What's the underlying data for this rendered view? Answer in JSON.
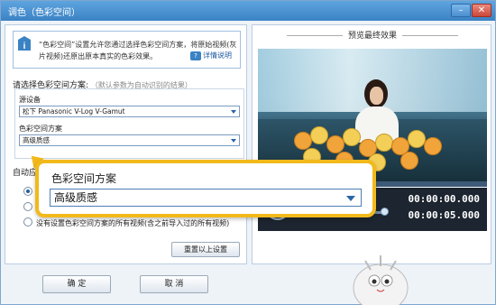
{
  "window": {
    "title": "调色（色彩空间）",
    "minimize_icon": "minimize-icon",
    "close_icon": "close-icon"
  },
  "info": {
    "text": "“色彩空间”设置允许您通过选择色彩空间方案，将原始视频(灰片视频)还原出原本真实的色彩效果。",
    "help_label": "详情说明",
    "help_icon": "help-icon"
  },
  "scheme": {
    "heading": "请选择色彩空间方案:",
    "hint": "（默认参数为自动识别的结果）",
    "source_label": "源设备",
    "source_value": "松下 Panasonic V-Log V-Gamut",
    "scheme_label": "色彩空间方案",
    "scheme_value": "高级质感"
  },
  "auto": {
    "heading": "自动应",
    "options": [
      {
        "label": "",
        "selected": true
      },
      {
        "label": "",
        "selected": false
      },
      {
        "label": "没有设置色彩空间方案的所有视频(含之前导入过的所有视频)",
        "selected": false
      }
    ],
    "reset_label": "重置以上设置"
  },
  "footer": {
    "ok_label": "确 定",
    "cancel_label": "取 消"
  },
  "preview": {
    "heading": "预览最终效果",
    "current_time": "00:00:00.000",
    "total_time": "00:00:05.000",
    "progress": 0.0,
    "volume": 0.95
  },
  "callout": {
    "title": "色彩空间方案",
    "value": "高级质感"
  },
  "colors": {
    "accent": "#3b82c4",
    "callout_border": "#f2b91b"
  }
}
